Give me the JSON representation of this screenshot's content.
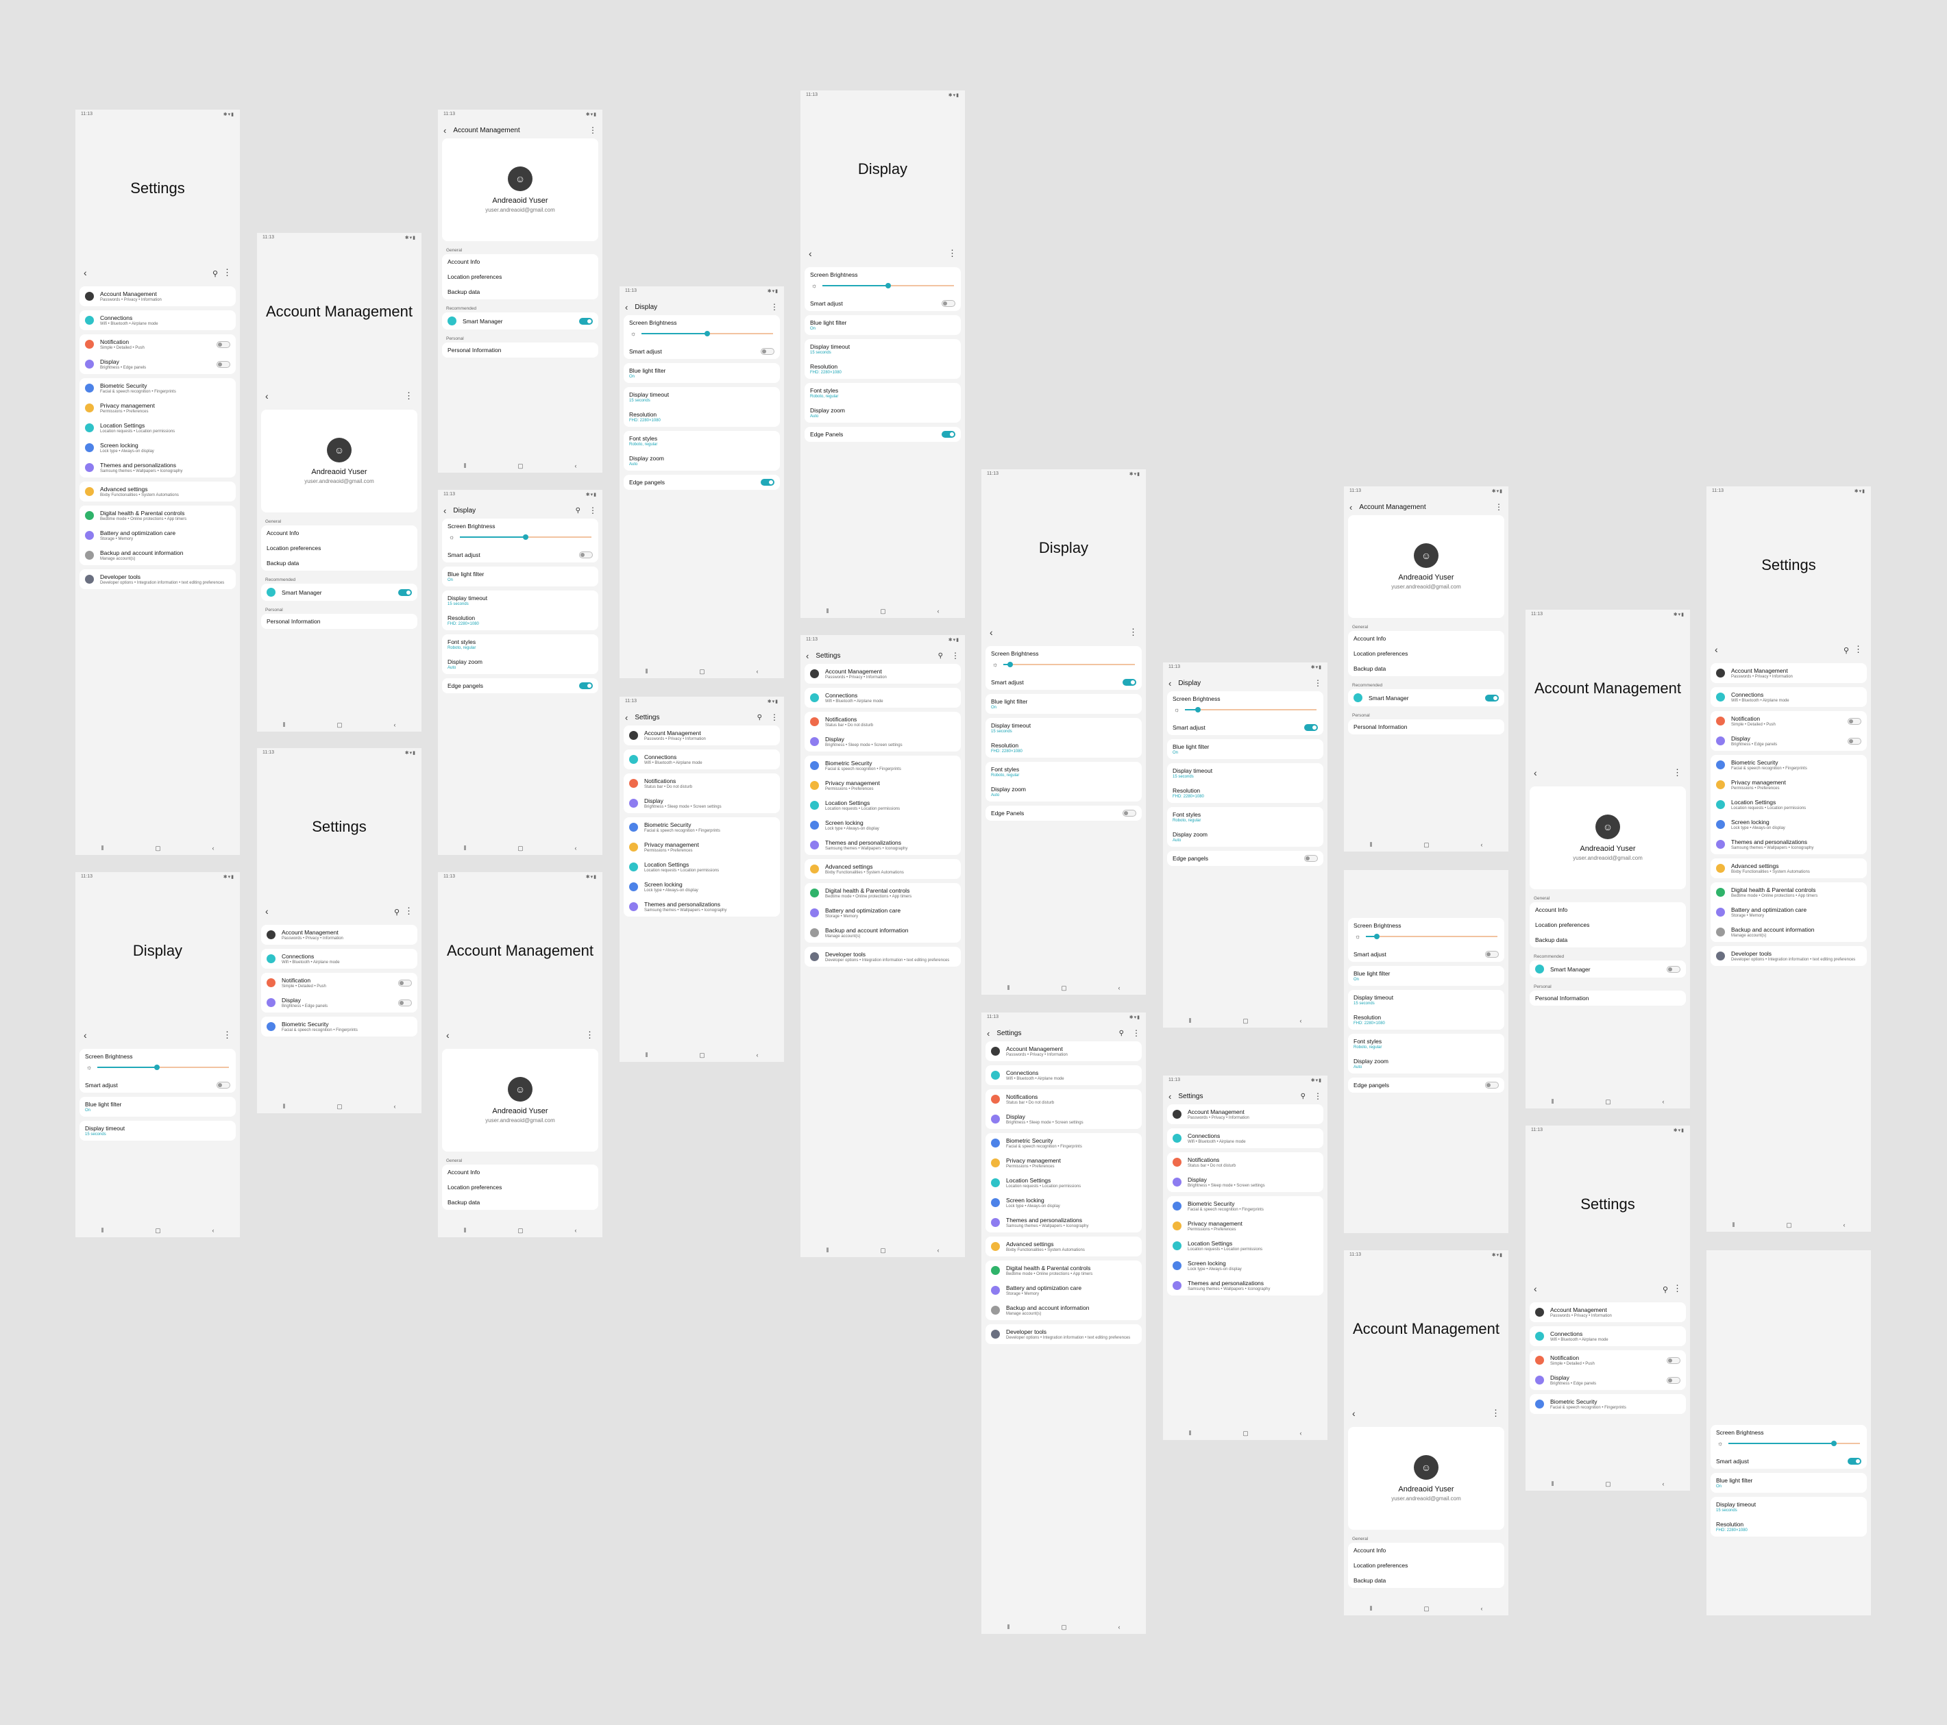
{
  "status_time": "11:13",
  "status_icons": "✱▾▮",
  "icons": {
    "back": "back-icon",
    "menu": "more-vert-icon",
    "search": "search-icon",
    "recents": "recents-icon",
    "home": "home-icon"
  },
  "glyphs": {
    "back": "‹",
    "menu": "⋮",
    "search": "⚲",
    "recents": "⦀",
    "home": "▢",
    "sun": "☼"
  },
  "colors": {
    "accent": "#20a8b8",
    "slider_track": "#f2c3a0",
    "background": "#e3e3e3"
  },
  "titles": {
    "settings": "Settings",
    "account": "Account Management",
    "display": "Display"
  },
  "profile": {
    "name": "Andreaoid Yuser",
    "email": "yuser.andreaoid@gmail.com"
  },
  "account": {
    "general": "General",
    "info": "Account Info",
    "location": "Location preferences",
    "backup": "Backup data",
    "backup_truncated": "Backup data",
    "recommended": "Recommended",
    "smart_manager": "Smart Manager",
    "personal": "Personal",
    "personal_info": "Personal Information"
  },
  "settings": {
    "account": {
      "label": "Account Management",
      "sub": "Passwords • Privacy • Information"
    },
    "connections": {
      "label": "Connections",
      "sub": "Wifi • Bluetooth • Airplane mode"
    },
    "notification": {
      "label": "Notification",
      "sub": "Simple • Detailed • Push"
    },
    "notifications": {
      "label": "Notifications",
      "sub": "Status bar • Do not disturb"
    },
    "display": {
      "label": "Display",
      "sub": "Brightness • Edge panels"
    },
    "display_alt": {
      "label": "Display",
      "sub": "Brightness • Sleep mode • Screen settings"
    },
    "biometric": {
      "label": "Biometric Security",
      "sub": "Facial & speech recognition • Fingerprints"
    },
    "privacy": {
      "label": "Privacy management",
      "sub": "Permissions • Preferences"
    },
    "location": {
      "label": "Location Settings",
      "sub": "Location requests • Location permissions"
    },
    "locking": {
      "label": "Screen locking",
      "sub": "Lock type • Always-on display"
    },
    "themes": {
      "label": "Themes and personalizations",
      "sub": "Samsung themes • Wallpapers • Iconography"
    },
    "advanced": {
      "label": "Advanced settings",
      "sub": "Bixby Functionalities • System Automations"
    },
    "digital": {
      "label": "Digital health & Parental controls",
      "sub": "Bedtime mode • Online protections • App timers"
    },
    "battery": {
      "label": "Battery and optimization care",
      "sub": "Storage • Memory"
    },
    "backup": {
      "label": "Backup and account information",
      "sub": "Manage account(s)"
    },
    "developer": {
      "label": "Developer tools",
      "sub": "Developer options • Integration information • text editing preferences"
    }
  },
  "display": {
    "brightness": "Screen Brightness",
    "smart_adjust": "Smart adjust",
    "blue_light": "Blue light filter",
    "blue_light_value": "On",
    "timeout": "Display timeout",
    "timeout_value": "15 seconds",
    "resolution": "Resolution",
    "resolution_value": "FHD: 2280×1080",
    "font_styles": "Font styles",
    "font_styles_value": "Roboto, regular",
    "zoom": "Display zoom",
    "zoom_value": "Auto",
    "edge_pangels": "Edge pangels",
    "edge_panels": "Edge Panels"
  },
  "toggles": {
    "on": "on",
    "off": "off"
  },
  "brightness_levels": [
    0.45,
    0.5,
    0.5,
    0.5,
    0.5,
    0.05,
    0.1,
    0.08,
    0.8
  ]
}
